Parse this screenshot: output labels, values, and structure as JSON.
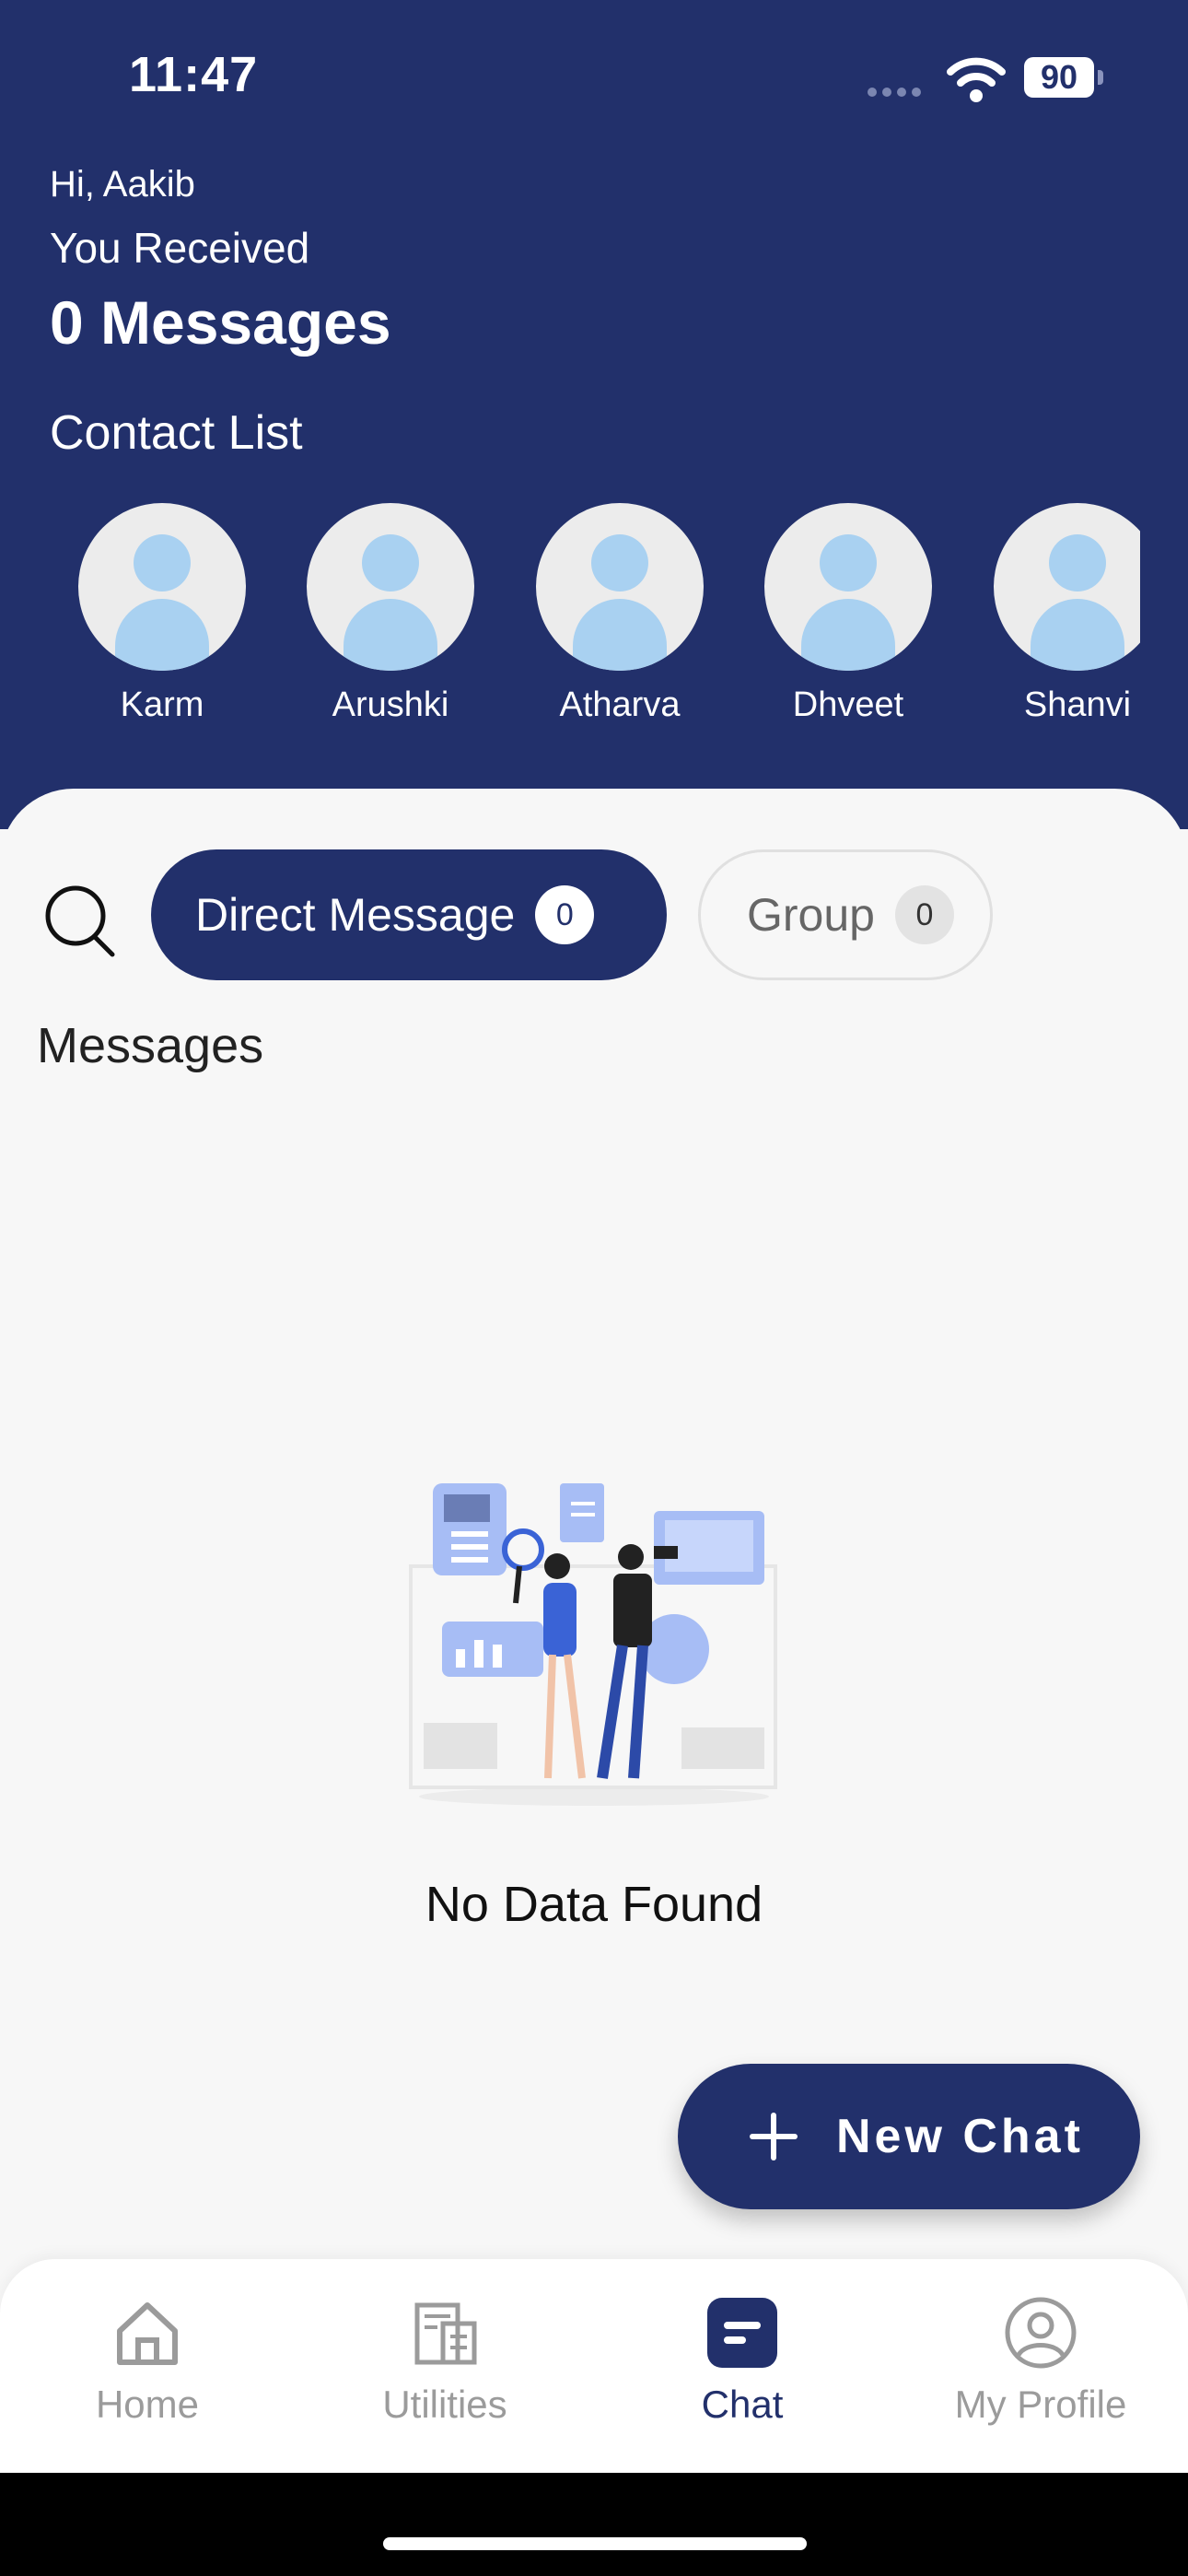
{
  "status_bar": {
    "time": "11:47",
    "battery": "90"
  },
  "header": {
    "greeting": "Hi, Aakib",
    "received_label": "You Received",
    "message_count": "0 Messages",
    "contact_list_title": "Contact List"
  },
  "contacts": [
    {
      "name": "Karm"
    },
    {
      "name": "Arushki"
    },
    {
      "name": "Atharva"
    },
    {
      "name": "Dhveet"
    },
    {
      "name": "Shanvi"
    }
  ],
  "filters": {
    "direct_message": {
      "label": "Direct Message",
      "count": "0"
    },
    "group": {
      "label": "Group",
      "count": "0"
    }
  },
  "messages_title": "Messages",
  "empty_state": {
    "text": "No Data Found"
  },
  "new_chat_button": {
    "label": "New Chat"
  },
  "tab_bar": {
    "items": [
      {
        "label": "Home",
        "icon": "home-icon"
      },
      {
        "label": "Utilities",
        "icon": "utilities-icon"
      },
      {
        "label": "Chat",
        "icon": "chat-icon",
        "active": true
      },
      {
        "label": "My Profile",
        "icon": "profile-icon"
      }
    ]
  },
  "colors": {
    "primary": "#22306b",
    "avatar_fill": "#a9d1f1",
    "background": "#f7f7f7"
  }
}
